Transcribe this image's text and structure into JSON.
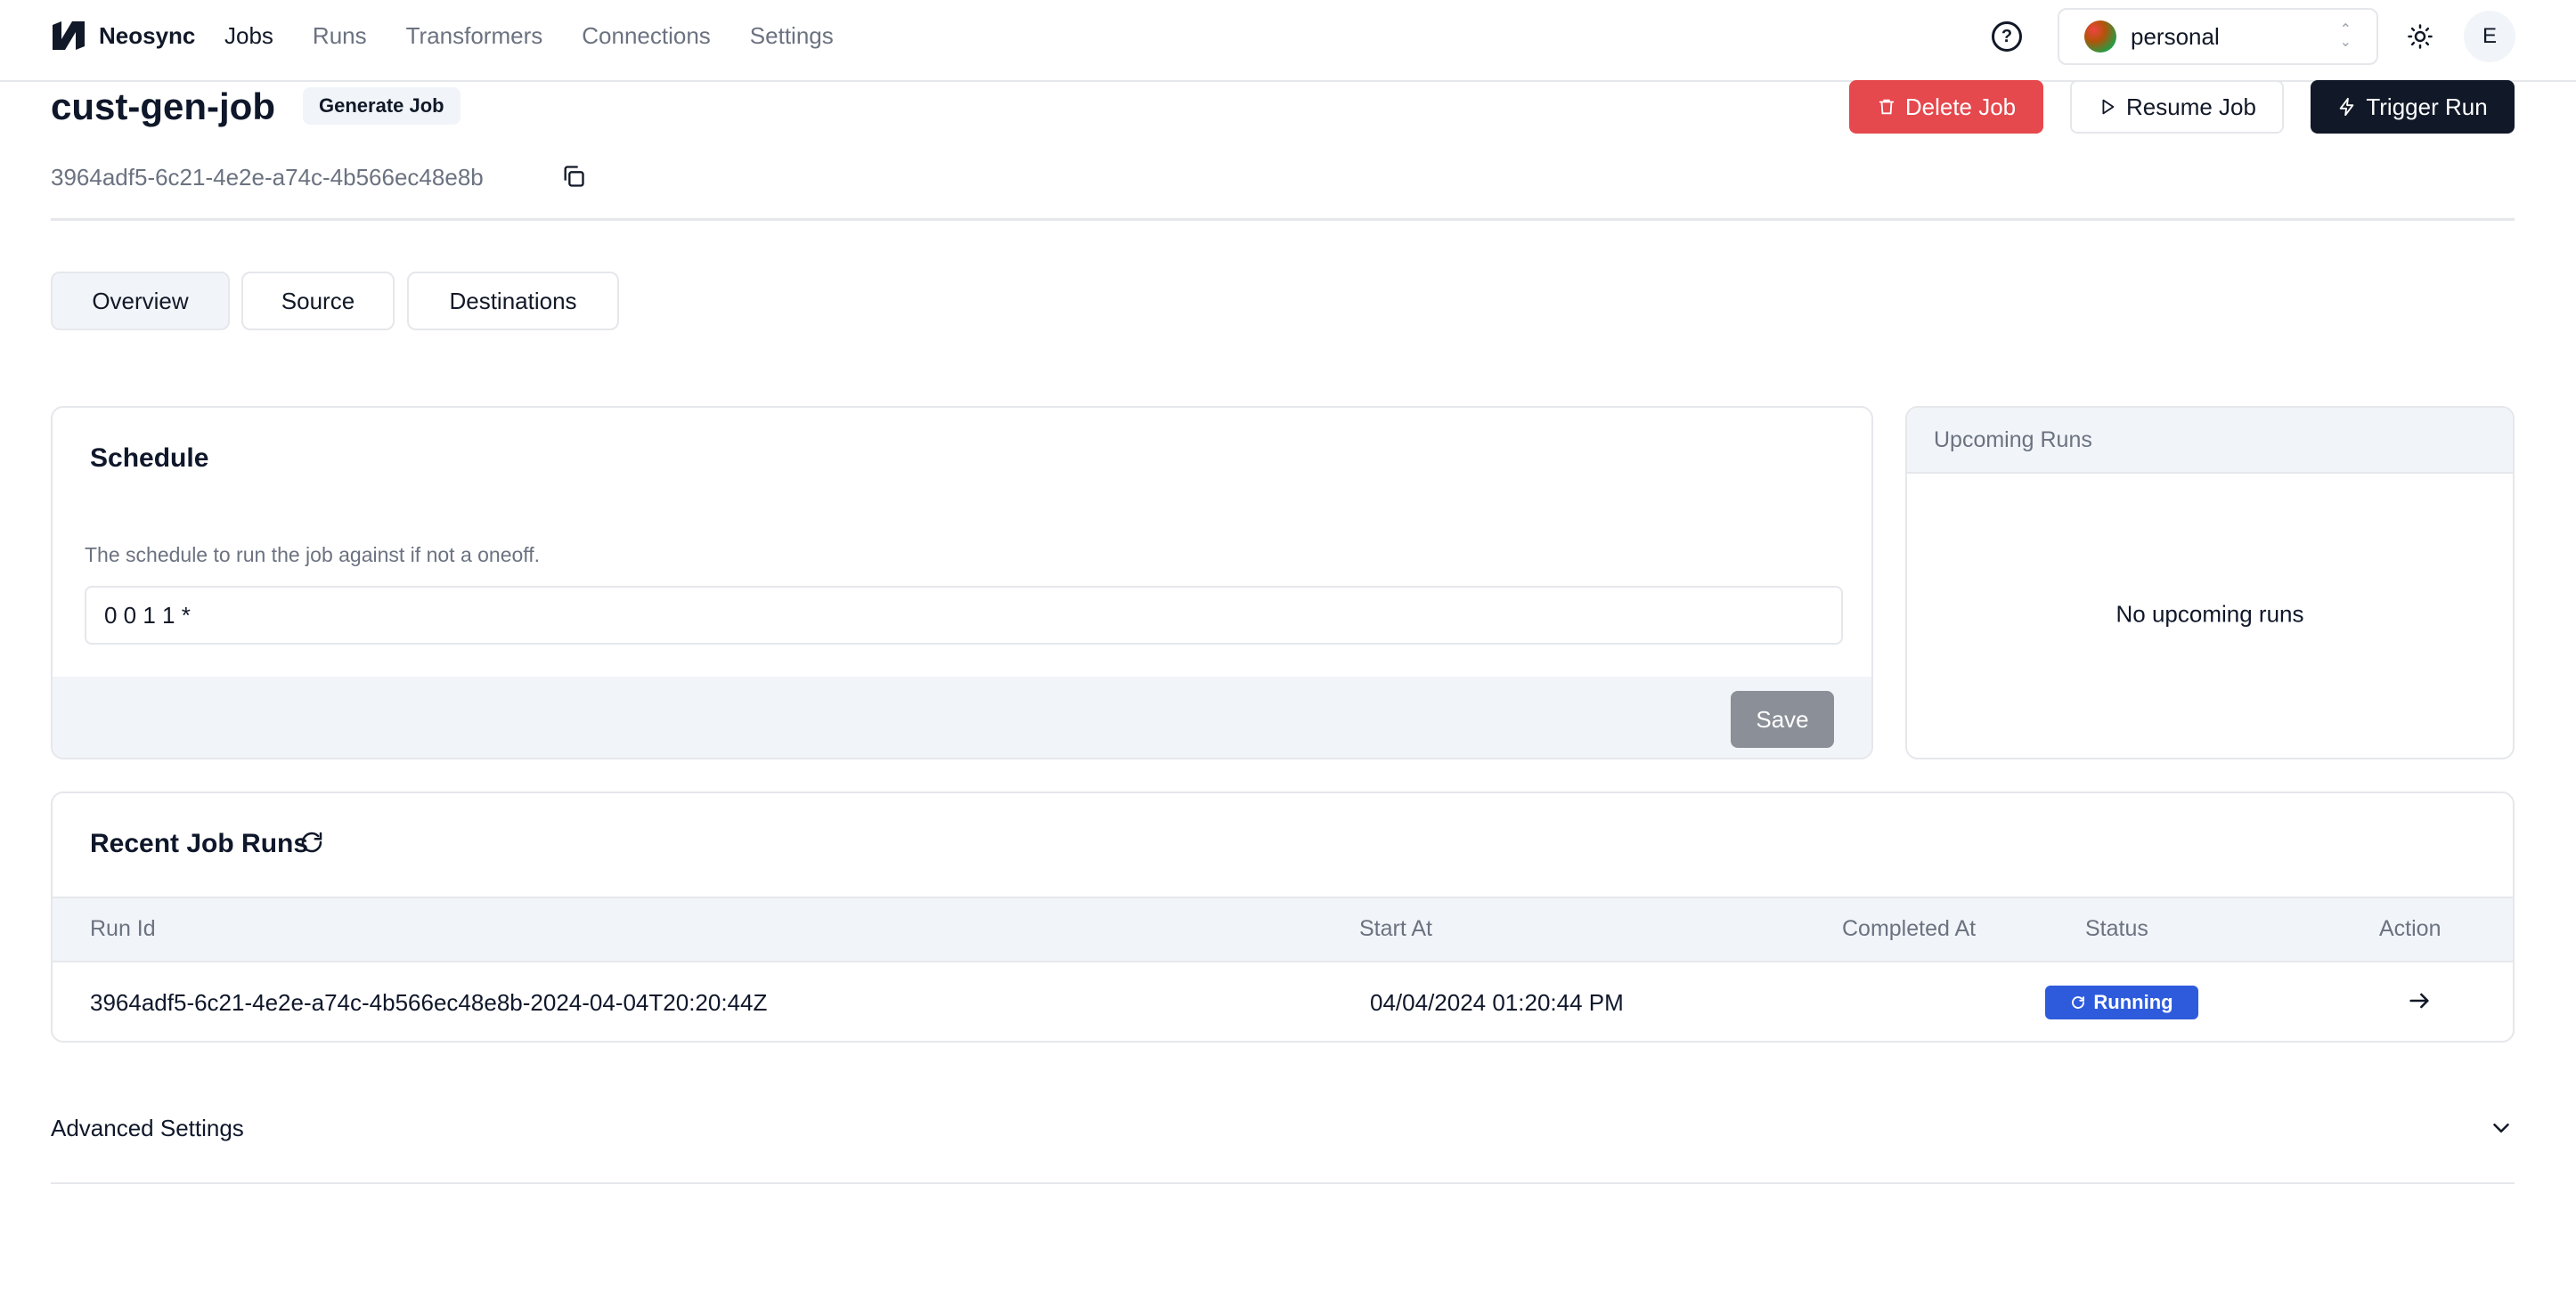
{
  "nav": {
    "brand": "Neosync",
    "links": [
      {
        "label": "Jobs"
      },
      {
        "label": "Runs"
      },
      {
        "label": "Transformers"
      },
      {
        "label": "Connections"
      },
      {
        "label": "Settings"
      }
    ],
    "account": "personal",
    "user_initial": "E"
  },
  "header": {
    "job_name": "cust-gen-job",
    "badge": "Generate Job",
    "job_id": "3964adf5-6c21-4e2e-a74c-4b566ec48e8b",
    "delete_label": "Delete Job",
    "resume_label": "Resume Job",
    "trigger_label": "Trigger Run"
  },
  "tabs": [
    {
      "label": "Overview"
    },
    {
      "label": "Source"
    },
    {
      "label": "Destinations"
    }
  ],
  "schedule": {
    "title": "Schedule",
    "description": "The schedule to run the job against if not a oneoff.",
    "value": "0 0 1 1 *",
    "save_label": "Save"
  },
  "upcoming": {
    "title": "Upcoming Runs",
    "empty": "No upcoming runs"
  },
  "recent_runs": {
    "title": "Recent Job Runs",
    "columns": [
      "Run Id",
      "Start At",
      "Completed At",
      "Status",
      "Action"
    ],
    "rows": [
      {
        "run_id": "3964adf5-6c21-4e2e-a74c-4b566ec48e8b-2024-04-04T20:20:44Z",
        "start_at": "04/04/2024 01:20:44 PM",
        "completed_at": "",
        "status": "Running"
      }
    ]
  },
  "advanced": {
    "label": "Advanced Settings"
  },
  "colors": {
    "danger": "#e5484d",
    "primary_dark": "#111827",
    "status_running": "#2e5bdb",
    "muted_surface": "#f1f5f9"
  },
  "icons": {
    "help": "question-circle-icon",
    "theme": "sun-icon",
    "copy": "copy-icon",
    "refresh": "refresh-icon",
    "action": "arrow-right-icon",
    "advanced": "chevron-down-icon"
  }
}
